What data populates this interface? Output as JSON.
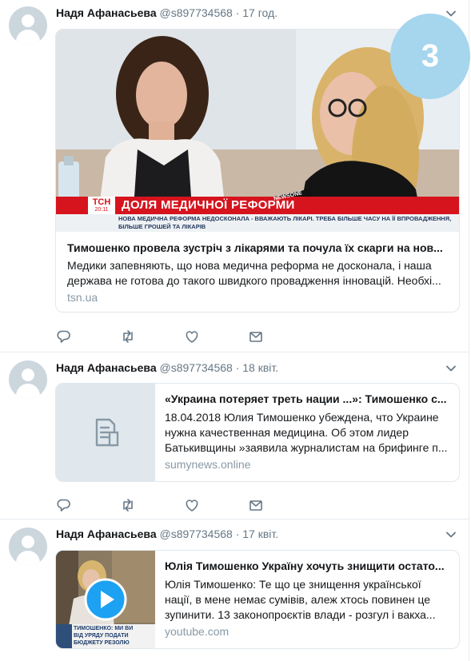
{
  "tweets": [
    {
      "name": "Надя Афанасьева",
      "handle": "@s897734568",
      "dot": "·",
      "time": "17 год.",
      "card": {
        "image_banner": "ДОЛЯ МЕДИЧНОЇ РЕФОРМИ",
        "image_ticker_1": "НОВА МЕДИЧНА РЕФОРМА НЕДОСКОНАЛА - ВВАЖАЮТЬ ЛІКАРІ. ТРЕБА БІЛЬШЕ ЧАСУ НА ЇЇ ВПРОВАДЖЕННЯ,",
        "image_ticker_2": "БІЛЬШЕ ГРОШЕЙ ТА ЛІКАРІВ",
        "image_logo": "ТСН",
        "image_logo_time": "20:11",
        "image_mic": "NEWSONE",
        "title": "Тимошенко провела зустріч з лікарями та почула їх скарги на нов...",
        "description": "Медики запевняють, що нова медична реформа не досконала, і наша держава не готова до такого швидкого провадження інновацій. Необхі...",
        "domain": "tsn.ua"
      }
    },
    {
      "name": "Надя Афанасьева",
      "handle": "@s897734568",
      "dot": "·",
      "time": "18 квіт.",
      "card": {
        "title": "«Украина потеряет треть нации ...»: Тимошенко с...",
        "description": "18.04.2018 Юлия Тимошенко убеждена, что Украине нужна качественная медицина. Об этом лидер Батькивщины »заявила журналистам на брифинге п...",
        "domain": "sumynews.online"
      }
    },
    {
      "name": "Надя Афанасьева",
      "handle": "@s897734568",
      "dot": "·",
      "time": "17 квіт.",
      "card": {
        "image_caption_1": "ТИМОШЕНКО: МИ ВИ",
        "image_caption_2": "ВІД УРЯДУ ПОДАТИ",
        "image_caption_3": "БЮДЖЕТУ РЕЗОЛЮ",
        "title": "Юлія Тимошенко Україну хочуть знищити остато...",
        "description": "Юлія Тимошенко: Те що це знищення української нації, в мене немає сумівів, алеж хтось повинен це зупинити. 13 законопроєктів влади - розгул і вакха...",
        "domain": "youtube.com"
      }
    }
  ],
  "badge": "3",
  "icons": {
    "avatar": "default-avatar-icon",
    "caret": "chevron-down-icon",
    "reply": "reply-icon",
    "retweet": "retweet-icon",
    "like": "heart-icon",
    "dm": "envelope-icon",
    "doc": "document-icon",
    "play": "play-icon"
  },
  "colors": {
    "icon_gray": "#657786",
    "border": "#e1e8ed",
    "badge_blue": "#a6d5ee",
    "tsn_red": "#d6141e"
  }
}
